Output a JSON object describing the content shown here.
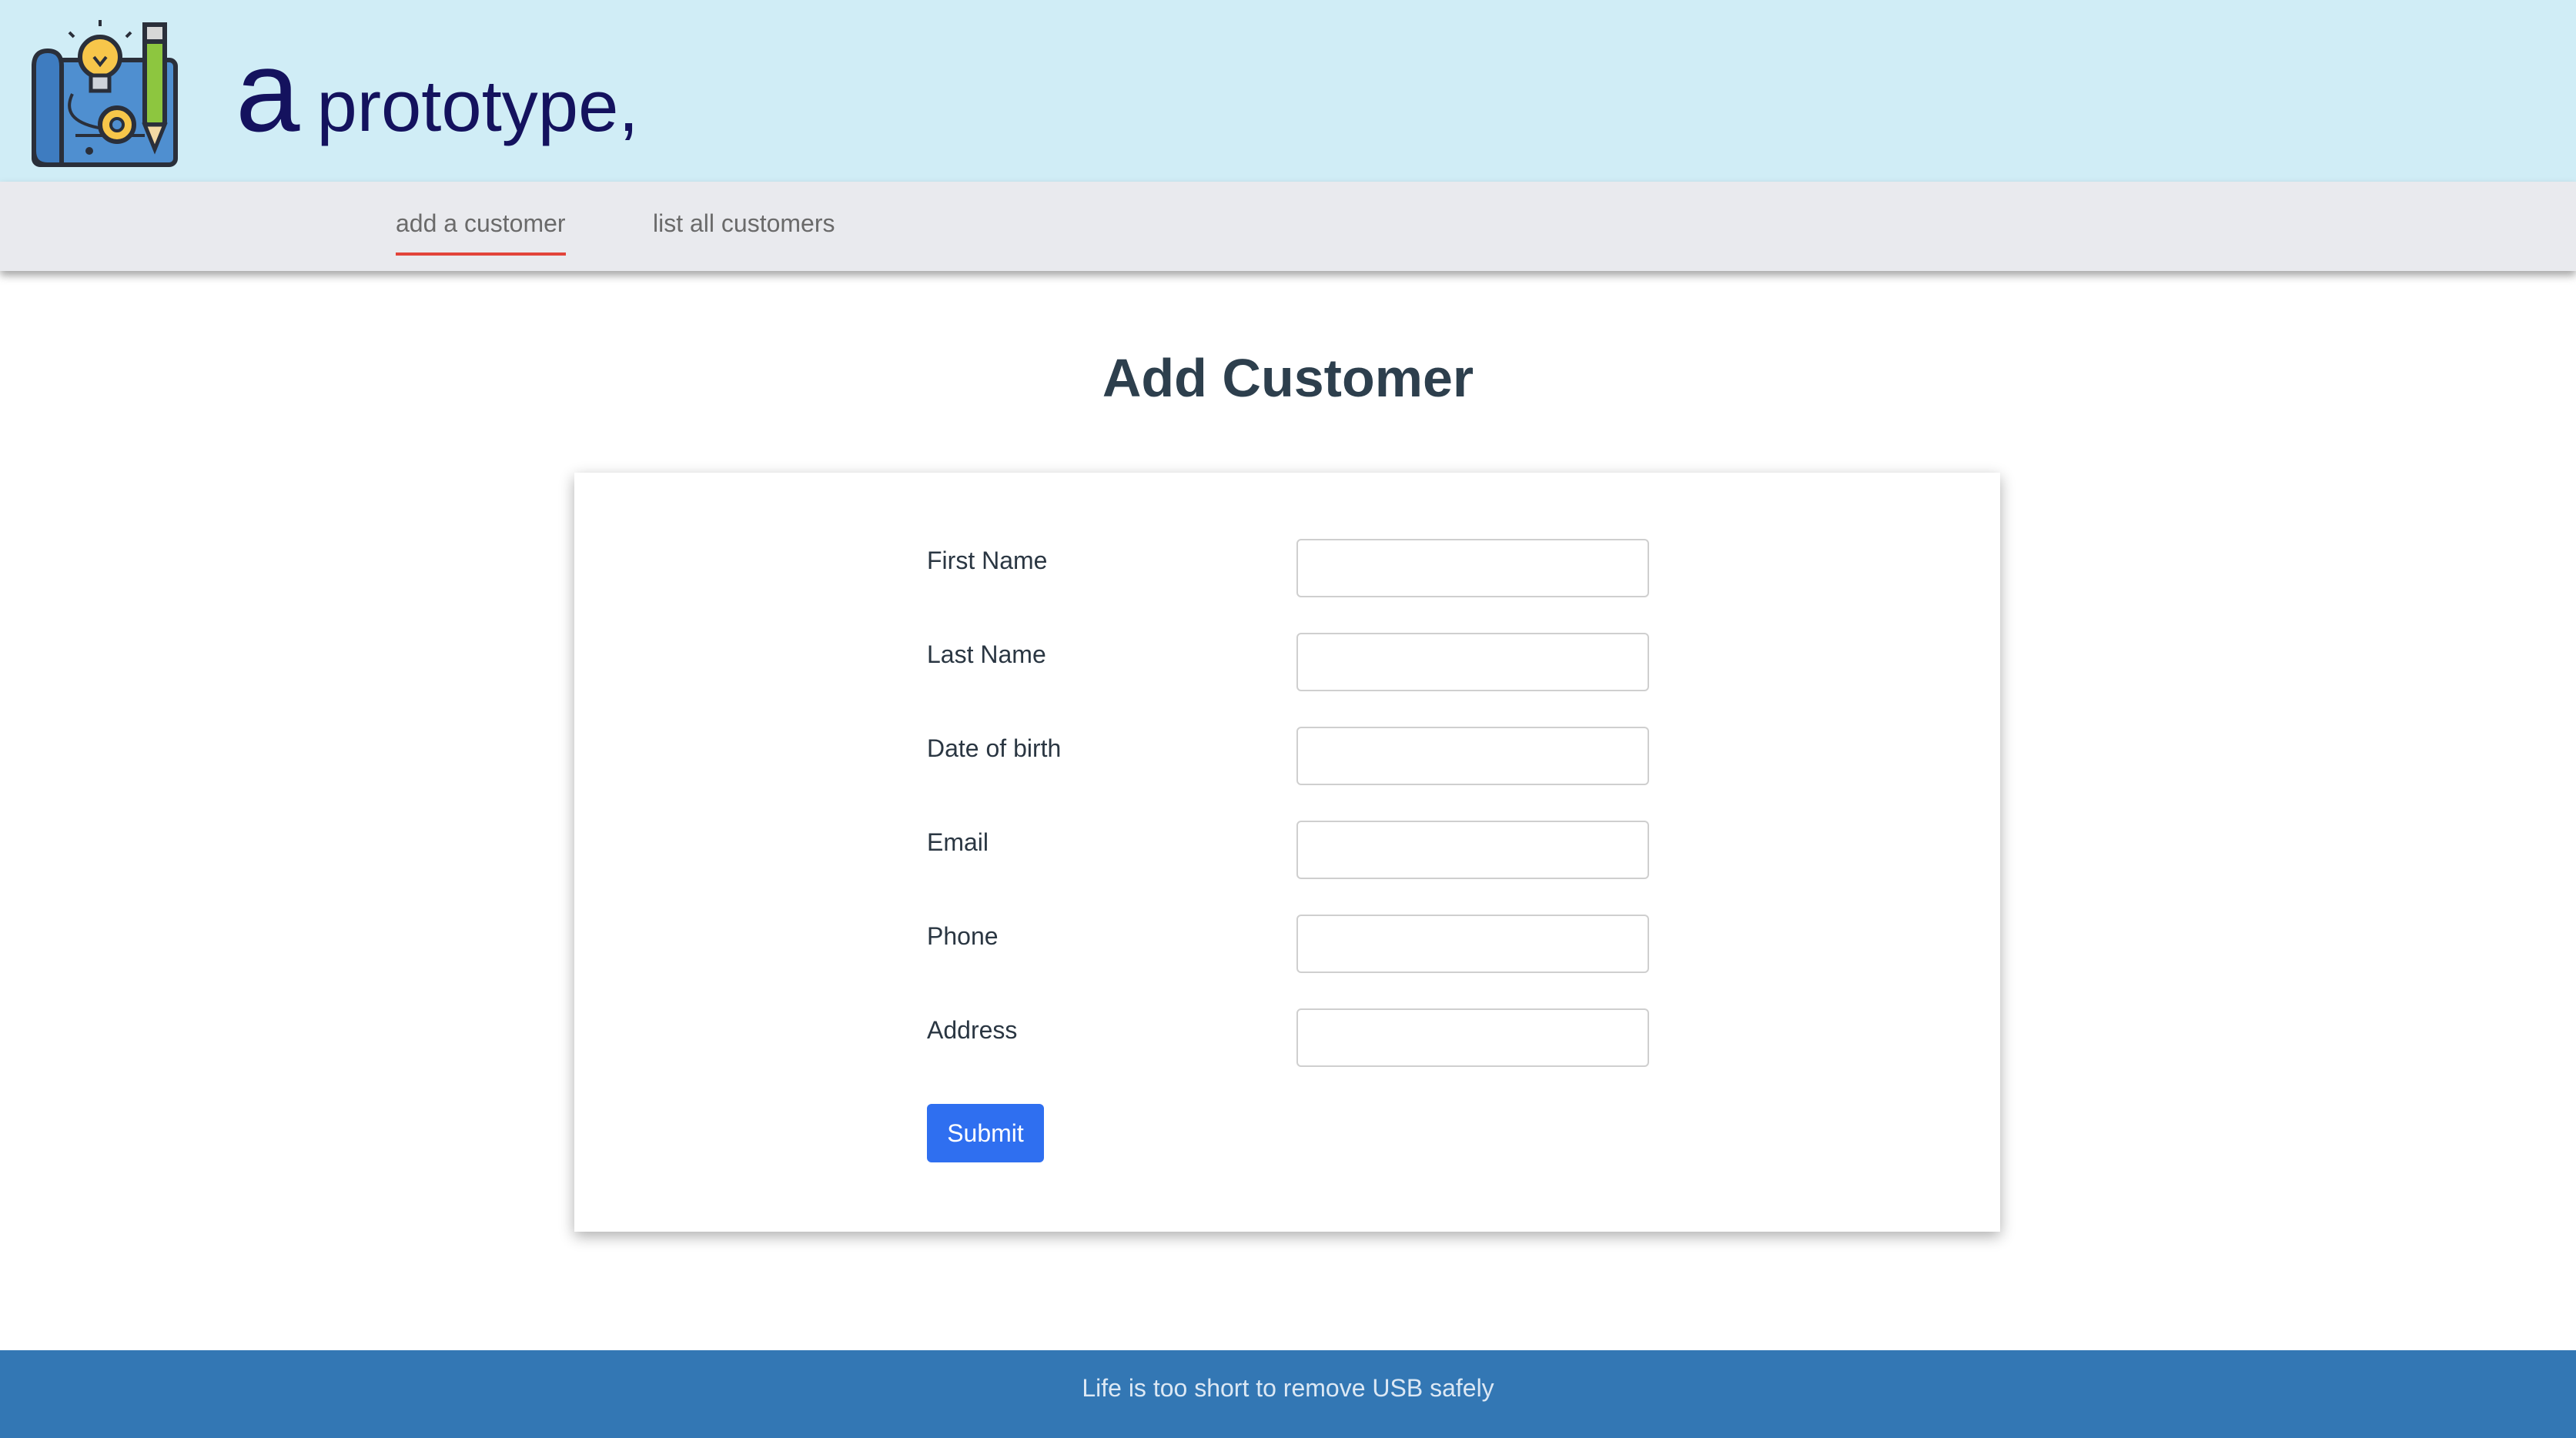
{
  "header": {
    "brand_a": "a",
    "brand_rest": "prototype,",
    "logo_icon": "blueprint-lightbulb-gear-pencil-icon"
  },
  "nav": {
    "items": [
      {
        "label": "add a customer",
        "active": true
      },
      {
        "label": "list all customers",
        "active": false
      }
    ]
  },
  "main": {
    "title": "Add Customer",
    "form": {
      "fields": [
        {
          "label": "First Name",
          "value": "",
          "placeholder": ""
        },
        {
          "label": "Last Name",
          "value": "",
          "placeholder": ""
        },
        {
          "label": "Date of birth",
          "value": "",
          "placeholder": ""
        },
        {
          "label": "Email",
          "value": "",
          "placeholder": ""
        },
        {
          "label": "Phone",
          "value": "",
          "placeholder": ""
        },
        {
          "label": "Address",
          "value": "",
          "placeholder": ""
        }
      ],
      "submit_label": "Submit"
    }
  },
  "footer": {
    "text": "Life is too short to remove USB safely"
  },
  "colors": {
    "header_bg": "#d0edf6",
    "nav_bg": "#e9eaee",
    "nav_active_underline": "#e2443a",
    "title": "#2d3f4d",
    "submit_bg": "#2f6ff0",
    "footer_bg": "#3377b4"
  }
}
